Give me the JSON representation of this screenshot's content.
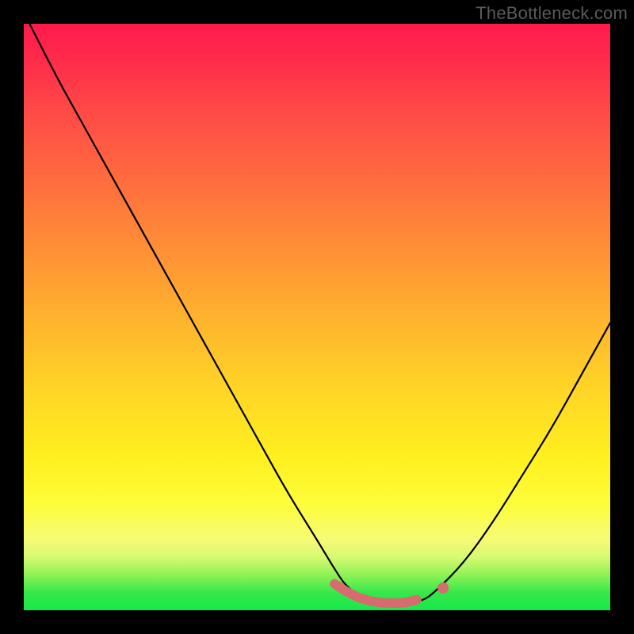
{
  "watermark": {
    "text": "TheBottleneck.com"
  },
  "colors": {
    "curve_stroke": "#000000",
    "marker_stroke": "#d86b6e",
    "marker_fill": "#d86b6e"
  },
  "chart_data": {
    "type": "line",
    "title": "",
    "xlabel": "",
    "ylabel": "",
    "xlim": [
      0,
      100
    ],
    "ylim": [
      0,
      100
    ],
    "grid": false,
    "series": [
      {
        "name": "bottleneck-curve",
        "x": [
          0,
          5,
          10,
          15,
          20,
          25,
          30,
          35,
          40,
          45,
          50,
          53,
          55,
          58,
          60,
          63,
          65,
          68,
          70,
          75,
          80,
          85,
          90,
          95,
          100
        ],
        "values": [
          102,
          92,
          83,
          74,
          65,
          56,
          47,
          38,
          29,
          20,
          12,
          7,
          4,
          2,
          1.3,
          1.1,
          1.2,
          1.6,
          3,
          8,
          15,
          23,
          31,
          40,
          49
        ]
      }
    ],
    "markers": [
      {
        "name": "trough-segment",
        "x": [
          53,
          55,
          57,
          59,
          61,
          63,
          65,
          67
        ],
        "y": [
          4.5,
          3.2,
          2.2,
          1.6,
          1.3,
          1.2,
          1.3,
          1.8
        ]
      },
      {
        "name": "right-marker",
        "x": [
          71.5
        ],
        "y": [
          3.8
        ]
      }
    ]
  }
}
